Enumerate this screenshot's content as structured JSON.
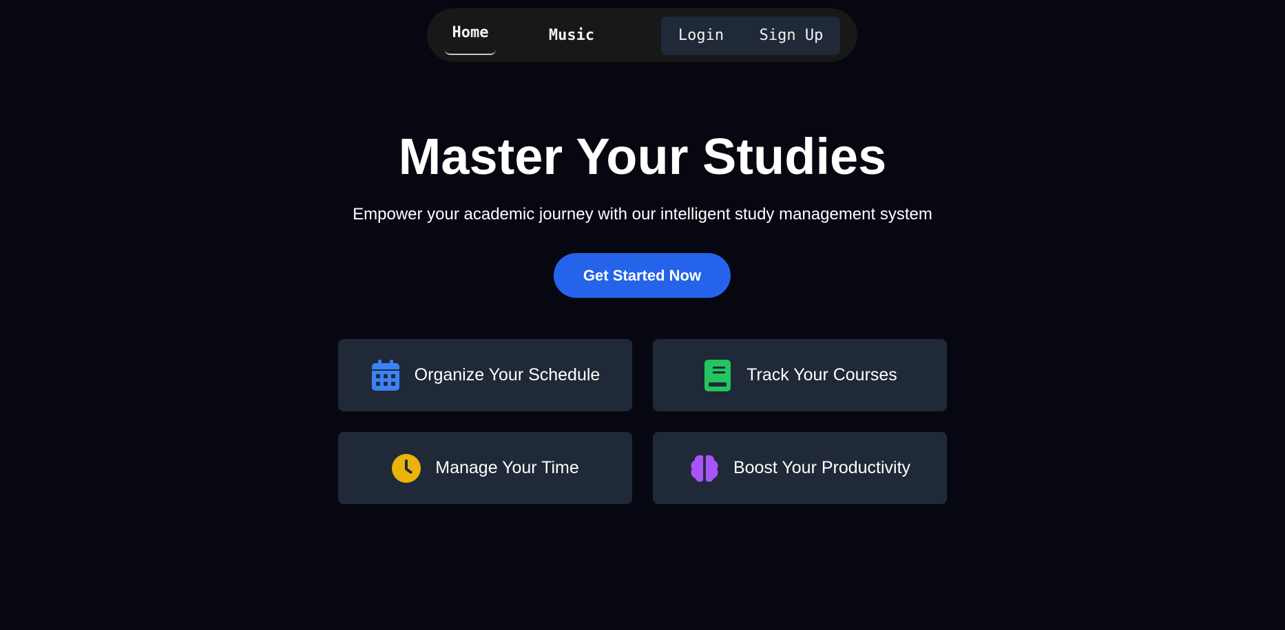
{
  "nav": {
    "home_label": "Home",
    "music_label": "Music",
    "login_label": "Login",
    "signup_label": "Sign Up"
  },
  "hero": {
    "title": "Master Your Studies",
    "subtitle": "Empower your academic journey with our intelligent study management system",
    "cta_label": "Get Started Now"
  },
  "features": [
    {
      "label": "Organize Your Schedule",
      "icon": "calendar-icon",
      "color": "#3b82f6"
    },
    {
      "label": "Track Your Courses",
      "icon": "book-icon",
      "color": "#22c55e"
    },
    {
      "label": "Manage Your Time",
      "icon": "clock-icon",
      "color": "#eab308"
    },
    {
      "label": "Boost Your Productivity",
      "icon": "brain-icon",
      "color": "#a855f7"
    }
  ],
  "colors": {
    "background": "#070712",
    "nav_background": "#181818",
    "card_background": "#1f2937",
    "accent": "#2563eb"
  }
}
